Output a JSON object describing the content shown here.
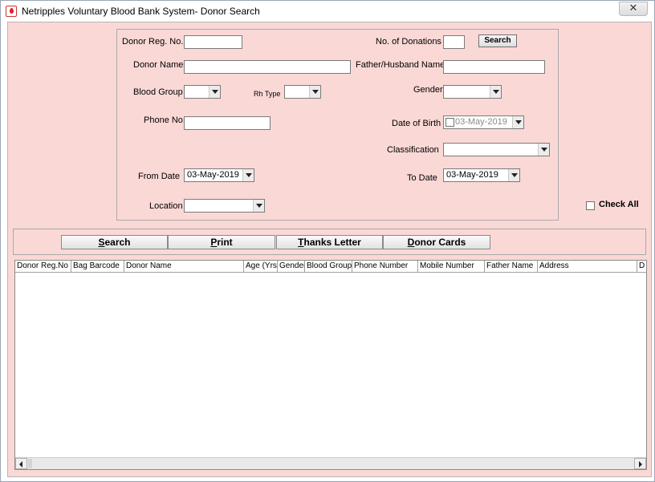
{
  "window": {
    "title": "Netripples Voluntary Blood Bank System- Donor Search",
    "close_glyph": "✕"
  },
  "form": {
    "donor_reg_no_label": "Donor Reg. No.",
    "donor_reg_no_value": "",
    "no_of_donations_label": "No. of Donations",
    "no_of_donations_value": "",
    "search_label": "Search",
    "donor_name_label": "Donor Name",
    "donor_name_value": "",
    "father_husband_label": "Father/Husband Name",
    "father_husband_value": "",
    "blood_group_label": "Blood Group",
    "blood_group_value": "",
    "rh_type_label": "Rh Type",
    "rh_type_value": "",
    "gender_label": "Gender",
    "gender_value": "",
    "phone_label": "Phone No.",
    "phone_value": "",
    "dob_label": "Date of Birth",
    "dob_value": "03-May-2019",
    "classification_label": "Classification",
    "classification_value": "",
    "from_date_label": "From Date",
    "from_date_value": "03-May-2019",
    "to_date_label": "To Date",
    "to_date_value": "03-May-2019",
    "location_label": "Location",
    "location_value": "",
    "check_all_label": "Check All"
  },
  "actions": {
    "search_first": "S",
    "search_rest": "earch",
    "print_first": "P",
    "print_rest": "rint",
    "thanks_first": "T",
    "thanks_rest": "hanks Letter",
    "donor_first": "D",
    "donor_rest": "onor Cards"
  },
  "grid": {
    "columns": [
      "Donor Reg.No",
      "Bag Barcode",
      "Donor Name",
      "Age (Yrs)",
      "Gender",
      "Blood Group",
      "Phone Number",
      "Mobile Number",
      "Father Name",
      "Address",
      "D"
    ]
  },
  "colors": {
    "client_bg": "#fad8d6",
    "grid_bg": "#ffffff"
  },
  "icons": {
    "app": "blood-drop-icon",
    "dropdown": "chevron-down-icon"
  }
}
